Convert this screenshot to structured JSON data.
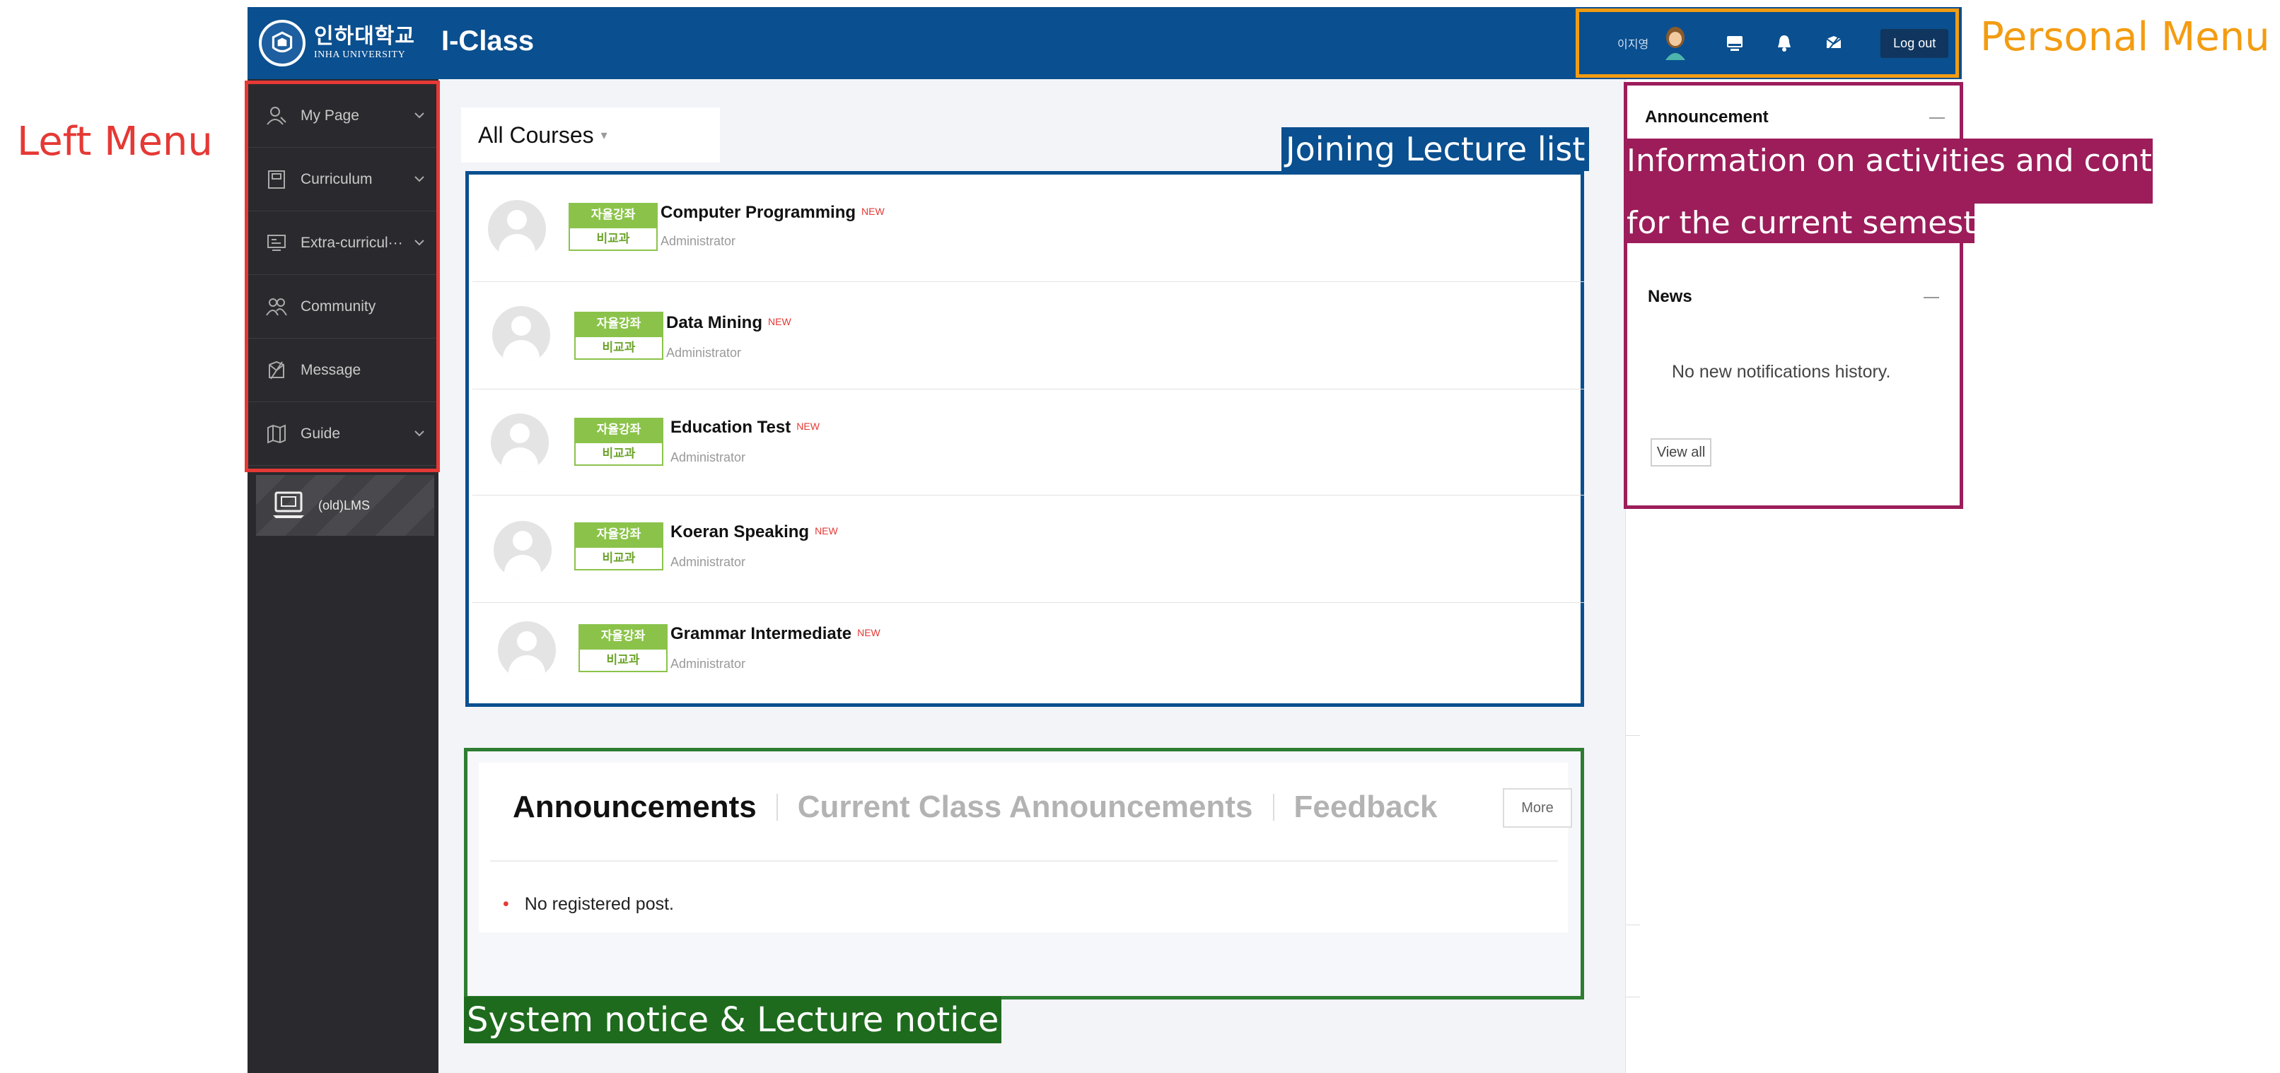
{
  "app": {
    "university_korean": "인하대학교",
    "university_english": "INHA UNIVERSITY",
    "title": "I-Class"
  },
  "personal_menu": {
    "user_name": "이지영",
    "logout_label": "Log out",
    "icons": [
      "user-avatar",
      "monitor-icon",
      "bell-icon",
      "message-icon"
    ]
  },
  "sidebar": {
    "items": [
      {
        "label": "My Page",
        "icon": "user-icon",
        "expandable": true
      },
      {
        "label": "Curriculum",
        "icon": "book-icon",
        "expandable": true
      },
      {
        "label": "Extra-curricul···",
        "icon": "board-icon",
        "expandable": true
      },
      {
        "label": "Community",
        "icon": "people-icon",
        "expandable": false
      },
      {
        "label": "Message",
        "icon": "message-icon",
        "expandable": false
      },
      {
        "label": "Guide",
        "icon": "map-icon",
        "expandable": true
      }
    ],
    "old_lms_label": "(old)LMS"
  },
  "courses": {
    "filter_label": "All Courses",
    "new_label": "NEW",
    "badge_top": "자율강좌",
    "badge_bottom": "비교과",
    "list": [
      {
        "title": "Computer Programming",
        "instructor": "Administrator"
      },
      {
        "title": "Data Mining",
        "instructor": "Administrator"
      },
      {
        "title": "Education Test",
        "instructor": "Administrator"
      },
      {
        "title": "Koeran Speaking",
        "instructor": "Administrator"
      },
      {
        "title": "Grammar Intermediate",
        "instructor": "Administrator"
      }
    ]
  },
  "announcements": {
    "tabs": [
      "Announcements",
      "Current Class Announcements",
      "Feedback"
    ],
    "active_tab": "Announcements",
    "more_label": "More",
    "items": [
      "No registered post."
    ]
  },
  "right_panel": {
    "announcement_title": "Announcement",
    "news_title": "News",
    "news_empty": "No new notifications history.",
    "view_all_label": "View all"
  },
  "annotations": {
    "left_menu": "Left Menu",
    "personal_menu": "Personal Menu",
    "joining_lecture_list": "Joining Lecture list",
    "info_line1": "Information on activities and content",
    "info_line2": "for the current semester",
    "system_notice": "System notice & Lecture notice"
  },
  "colors": {
    "header": "#0a4f8f",
    "sidebar": "#2a2a2e",
    "left_menu_annotation": "#e53935",
    "personal_menu_annotation": "#f39c12",
    "lecture_list_annotation": "#0a4f8f",
    "info_annotation": "#9c1d5a",
    "notice_annotation": "#2e7d32",
    "badge_green": "#8bc34a"
  }
}
